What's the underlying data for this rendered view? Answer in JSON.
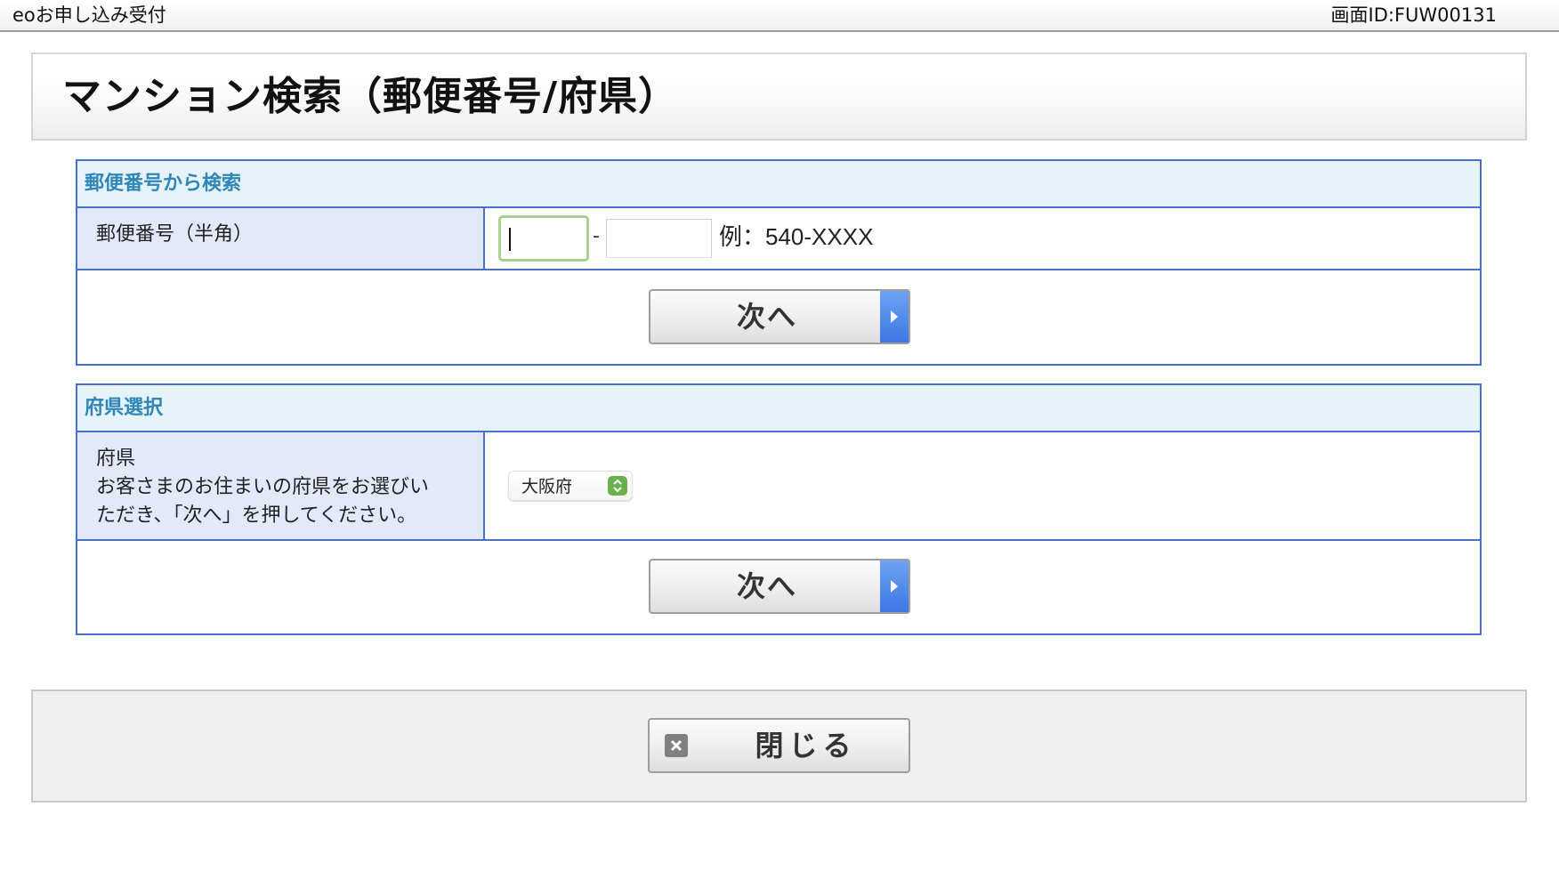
{
  "header": {
    "app_name": "eoお申し込み受付",
    "screen_id": "画面ID:FUW00131"
  },
  "page_title": "マンション検索（郵便番号/府県）",
  "zip_section": {
    "heading": "郵便番号から検索",
    "label": "郵便番号（半角）",
    "zip1_value": "",
    "zip2_value": "",
    "separator": "-",
    "example": "例：540-XXXX",
    "next_label": "次へ"
  },
  "pref_section": {
    "heading": "府県選択",
    "label_title": "府県",
    "label_line1": "お客さまのお住まいの府県をお選びい",
    "label_line2": "ただき、「次へ」を押してください。",
    "selected": "大阪府",
    "next_label": "次へ"
  },
  "footer": {
    "close_label": "閉じる"
  },
  "colors": {
    "border_blue": "#4a6fd0",
    "section_head_bg": "#e6f3fa",
    "section_head_text": "#2f87b7",
    "label_bg": "#e3e9fb",
    "arrow_blue": "#3c78e4",
    "select_green": "#6ab04c"
  },
  "icons": {
    "next_arrow": "triangle-right-icon",
    "select_arrow": "updown-chevron-icon",
    "close": "close-x-icon"
  }
}
